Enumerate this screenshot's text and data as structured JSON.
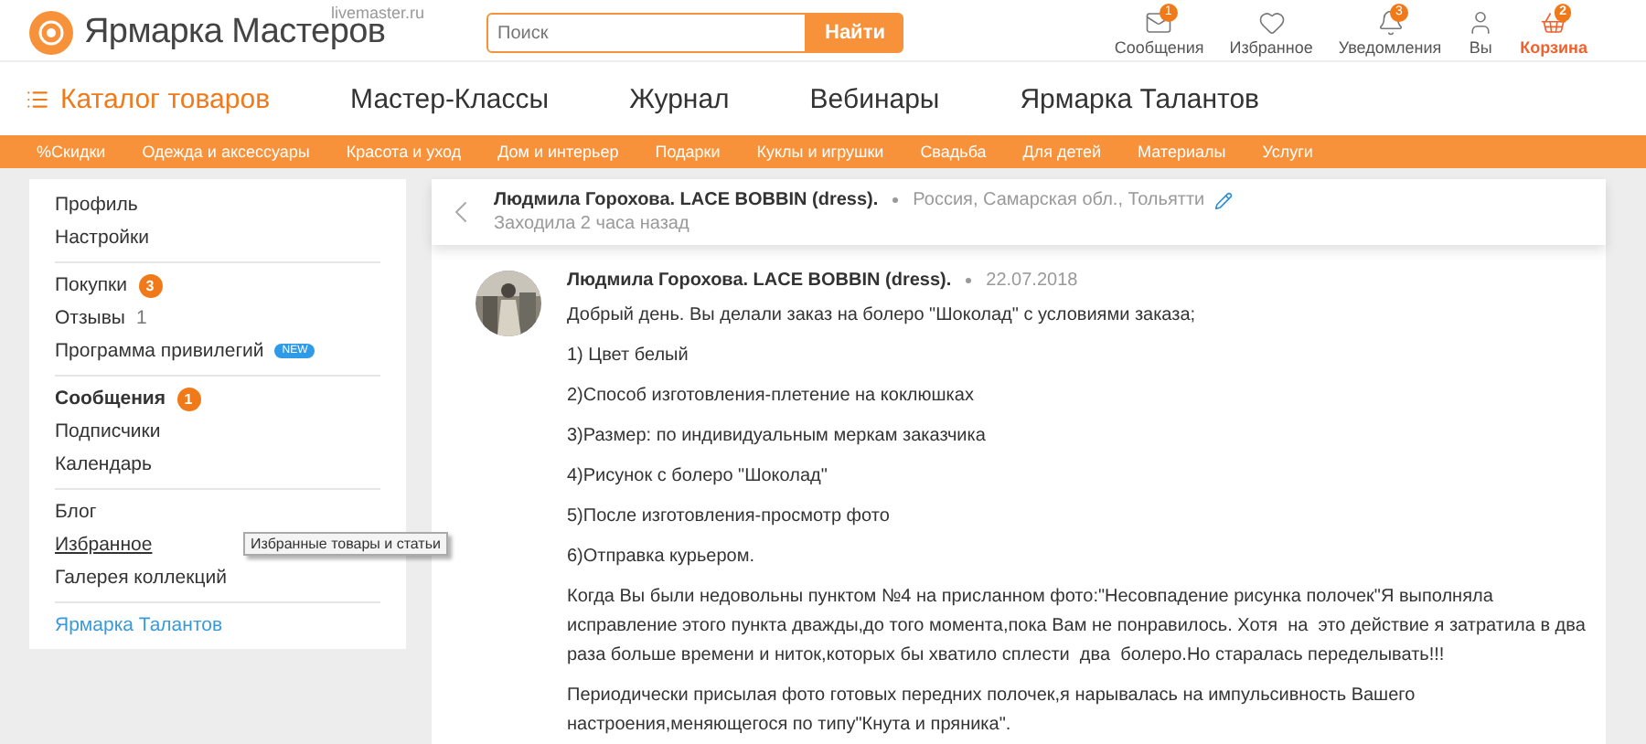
{
  "header": {
    "logo_text": "Ярмарка Мастеров",
    "logo_domain": "livemaster.ru",
    "search": {
      "placeholder": "Поиск"
    },
    "search_button": "Найти",
    "actions": [
      {
        "kind": "mail",
        "label": "Сообщения",
        "badge": "1",
        "highlighted": false
      },
      {
        "kind": "heart",
        "label": "Избранное",
        "highlighted": false
      },
      {
        "kind": "bell",
        "label": "Уведомления",
        "badge": "3",
        "highlighted": false
      },
      {
        "kind": "user",
        "label": "Вы",
        "highlighted": false
      },
      {
        "kind": "basket",
        "label": "Корзина",
        "badge": "2",
        "highlighted": true
      }
    ]
  },
  "nav": [
    {
      "label": "Каталог товаров",
      "selected": true
    },
    {
      "label": "Мастер-Классы",
      "selected": false
    },
    {
      "label": "Журнал",
      "selected": false
    },
    {
      "label": "Вебинары",
      "selected": false
    },
    {
      "label": "Ярмарка Талантов",
      "selected": false
    }
  ],
  "categories": [
    "%Скидки",
    "Одежда и аксессуары",
    "Красота и уход",
    "Дом и интерьер",
    "Подарки",
    "Куклы и игрушки",
    "Свадьба",
    "Для детей",
    "Материалы",
    "Услуги"
  ],
  "sidebar": {
    "groups": [
      {
        "items": [
          {
            "label": "Профиль",
            "selected": false,
            "hovered": false
          },
          {
            "label": "Настройки",
            "selected": false,
            "hovered": false
          }
        ]
      },
      {
        "items": [
          {
            "label": "Покупки",
            "badge": {
              "text": "3",
              "kind": "count"
            },
            "selected": false,
            "hovered": false
          },
          {
            "label": "Отзывы",
            "badge": {
              "text": "1",
              "kind": "plain"
            },
            "selected": false,
            "hovered": false
          },
          {
            "label": "Программа привилегий",
            "badge": {
              "text": "NEW",
              "kind": "new"
            },
            "selected": false,
            "hovered": false
          }
        ]
      },
      {
        "items": [
          {
            "label": "Сообщения",
            "badge": {
              "text": "1",
              "kind": "count"
            },
            "selected": true,
            "hovered": false
          },
          {
            "label": "Подписчики",
            "selected": false,
            "hovered": false
          },
          {
            "label": "Календарь",
            "selected": false,
            "hovered": false
          }
        ]
      },
      {
        "items": [
          {
            "label": "Блог",
            "selected": false,
            "hovered": false
          },
          {
            "label": "Избранное",
            "selected": false,
            "hovered": true,
            "tooltip": "Избранные товары и статьи"
          },
          {
            "label": "Галерея коллекций",
            "selected": false,
            "hovered": false
          }
        ]
      },
      {
        "items": [
          {
            "label": "Ярмарка Талантов",
            "kind": "link",
            "selected": false,
            "hovered": false
          }
        ]
      }
    ]
  },
  "conversation": {
    "name": "Людмила Горохова. LACE BOBBIN (dress).",
    "location": "Россия, Самарская обл., Тольятти",
    "last_seen": "Заходила 2 часа назад",
    "messages": [
      {
        "author": "Людмила Горохова. LACE BOBBIN (dress).",
        "date": "22.07.2018",
        "paragraphs": [
          "Добрый день. Вы делали заказ на болеро \"Шоколад\" с условиями заказа;",
          "1) Цвет белый",
          "2)Способ изготовления-плетение на коклюшках",
          "3)Размер: по индивидуальным меркам заказчика",
          "4)Рисунок с болеро \"Шоколад\"",
          "5)После изготовления-просмотр фото",
          "6)Отправка курьером.",
          "Когда Вы были недовольны пунктом №4 на присланном фото:\"Несовпадение рисунка полочек\"Я выполняла исправление этого пункта дважды,до того момента,пока Вам не понравилось. Хотя  на  это действие я затратила в два раза больше времени и ниток,которых бы хватило сплести  два  болеро.Но старалась переделывать!!!",
          "Периодически присылая фото готовых передних полочек,я нарывалась на импульсивность Вашего настроения,меняющегося по типу\"Кнута и пряника\"."
        ]
      }
    ]
  }
}
